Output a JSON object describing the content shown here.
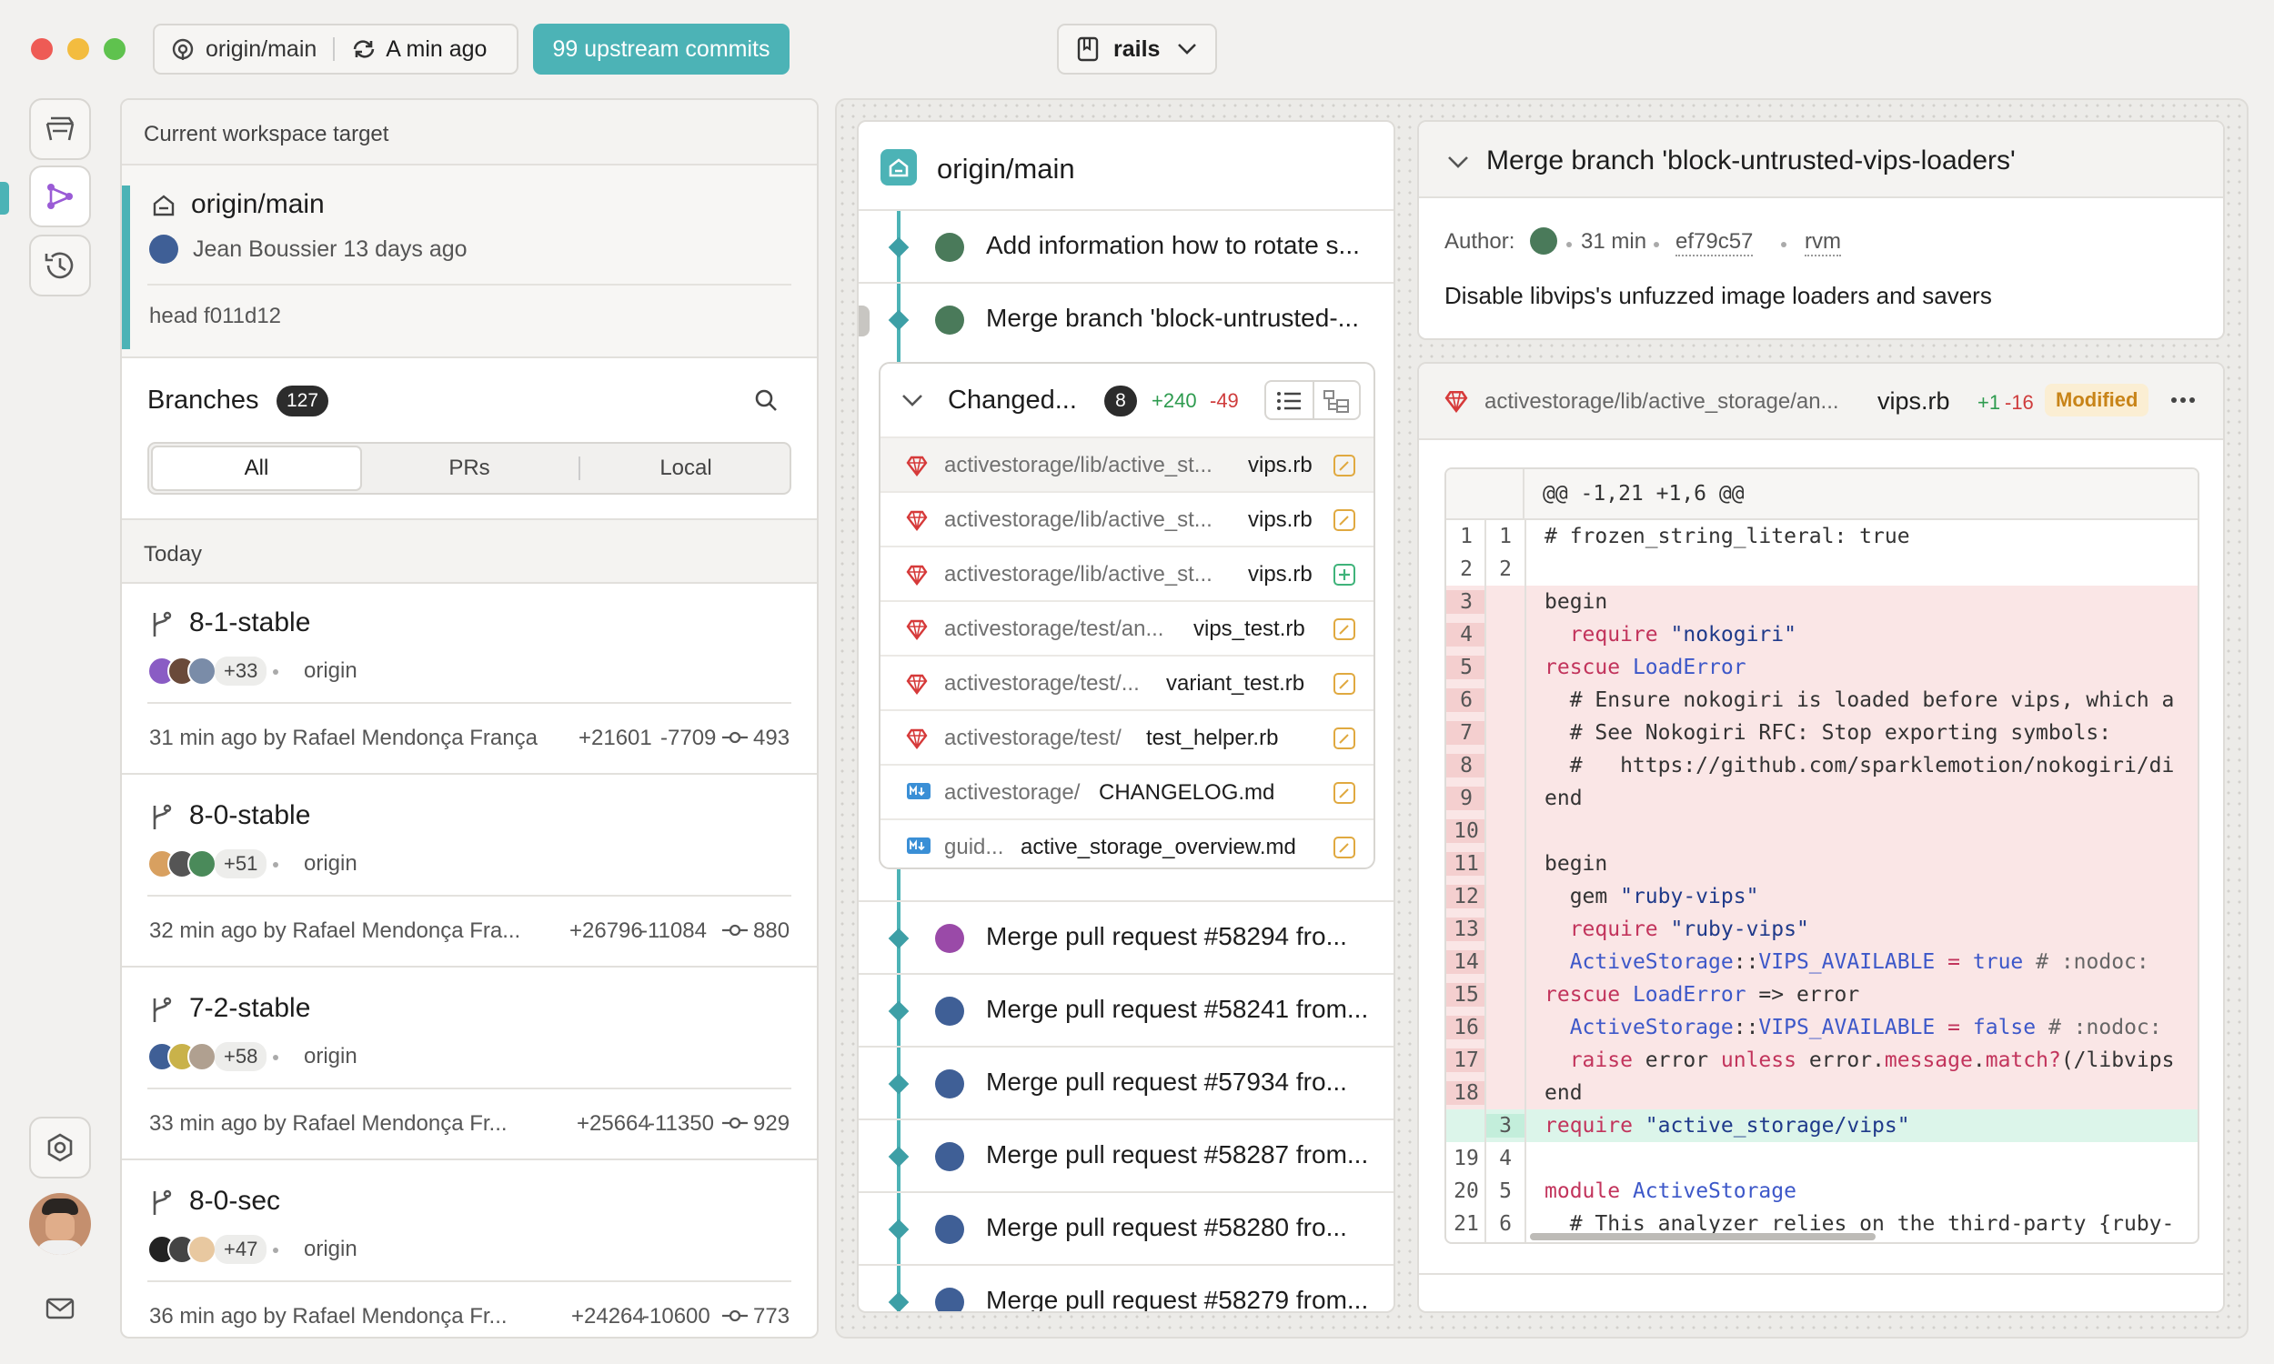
{
  "window": {
    "colors": {
      "close": "#ee5b55",
      "minimize": "#f3bc3f",
      "maximize": "#5fc24e",
      "accent": "#4cb3b6"
    }
  },
  "topbar": {
    "remote": "origin/main",
    "sync": "A min ago",
    "upstream_badge": "99 upstream commits",
    "repo": "rails"
  },
  "rail": {
    "icons": [
      "workspace-icon",
      "branches-icon",
      "history-icon",
      "settings-icon",
      "avatar",
      "mail-icon"
    ]
  },
  "target": {
    "header": "Current workspace target",
    "name": "origin/main",
    "author_line": "Jean Boussier 13 days ago",
    "head": "head f011d12"
  },
  "branches": {
    "title": "Branches",
    "count": "127",
    "filters": [
      "All",
      "PRs",
      "Local"
    ],
    "section": "Today",
    "items": [
      {
        "name": "8-1-stable",
        "plus": "+33",
        "remote": "origin",
        "meta": "31 min ago by Rafael Mendonça França",
        "add": "+21601",
        "del": "-7709",
        "commits": "493"
      },
      {
        "name": "8-0-stable",
        "plus": "+51",
        "remote": "origin",
        "meta": "32 min ago by Rafael Mendonça Fra...",
        "add": "+26796",
        "del": "-11084",
        "commits": "880"
      },
      {
        "name": "7-2-stable",
        "plus": "+58",
        "remote": "origin",
        "meta": "33 min ago by Rafael Mendonça Fr...",
        "add": "+25664",
        "del": "-11350",
        "commits": "929"
      },
      {
        "name": "8-0-sec",
        "plus": "+47",
        "remote": "origin",
        "meta": "36 min ago by Rafael Mendonça Fr...",
        "add": "+24264",
        "del": "-10600",
        "commits": "773"
      }
    ]
  },
  "commits": {
    "title": "origin/main",
    "top": [
      "Add information how to rotate s...",
      "Merge branch 'block-untrusted-..."
    ],
    "changed": {
      "label": "Changed...",
      "count": "8",
      "add": "+240",
      "del": "-49",
      "files": [
        {
          "path": "activestorage/lib/active_st...",
          "name": "vips.rb",
          "status": "modified"
        },
        {
          "path": "activestorage/lib/active_st...",
          "name": "vips.rb",
          "status": "modified"
        },
        {
          "path": "activestorage/lib/active_st...",
          "name": "vips.rb",
          "status": "added"
        },
        {
          "path": "activestorage/test/an...",
          "name": "vips_test.rb",
          "status": "modified"
        },
        {
          "path": "activestorage/test/...",
          "name": "variant_test.rb",
          "status": "modified"
        },
        {
          "path": "activestorage/test/",
          "name": "test_helper.rb",
          "status": "modified"
        },
        {
          "path": "activestorage/",
          "name": "CHANGELOG.md",
          "status": "modified"
        },
        {
          "path": "guid...",
          "name": "active_storage_overview.md",
          "status": "modified"
        }
      ]
    },
    "bottom": [
      "Merge pull request #58294 fro...",
      "Merge pull request #58241 from...",
      "Merge pull request #57934 fro...",
      "Merge pull request #58287 from...",
      "Merge pull request #58280 fro...",
      "Merge pull request #58279 from..."
    ]
  },
  "detail": {
    "title": "Merge branch 'block-untrusted-vips-loaders'",
    "author_label": "Author:",
    "time": "31 min",
    "sha": "ef79c57",
    "user": "rvm",
    "message": "Disable libvips's unfuzzed image loaders and savers"
  },
  "diff": {
    "path": "activestorage/lib/active_storage/an...",
    "file": "vips.rb",
    "add": "+1",
    "del": "-16",
    "status": "Modified",
    "hunk": "@@ -1,21 +1,6 @@"
  }
}
